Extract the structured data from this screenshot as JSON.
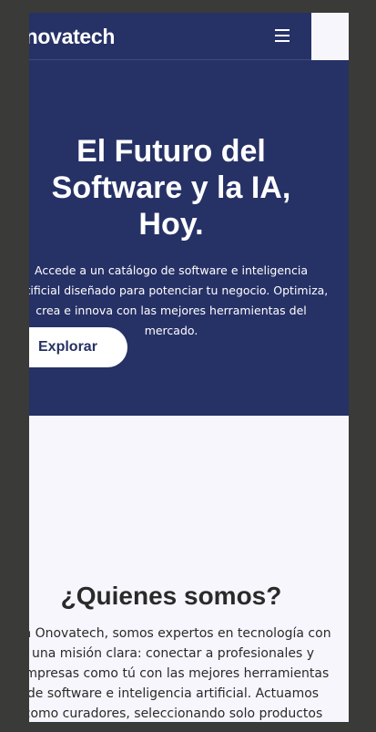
{
  "header": {
    "brand": "Onovatech",
    "menu_icon": "hamburger-menu-icon"
  },
  "hero": {
    "title": "El Futuro del Software y la IA, Hoy.",
    "description": "Accede a un catálogo de software e inteligencia artificial diseñado para potenciar tu negocio. Optimiza, crea e innova con las mejores herramientas del mercado.",
    "cta_label": "Explorar"
  },
  "about": {
    "title": "¿Quienes somos?",
    "text": "En Onovatech, somos expertos en tecnología con una misión clara: conectar a profesionales y empresas como tú con las mejores herramientas de software e inteligencia artificial. Actuamos como curadores, seleccionando solo productos que impulsan tu"
  },
  "colors": {
    "primary": "#263166",
    "background": "#f7f6fc",
    "page_backdrop": "#3a3a39"
  }
}
